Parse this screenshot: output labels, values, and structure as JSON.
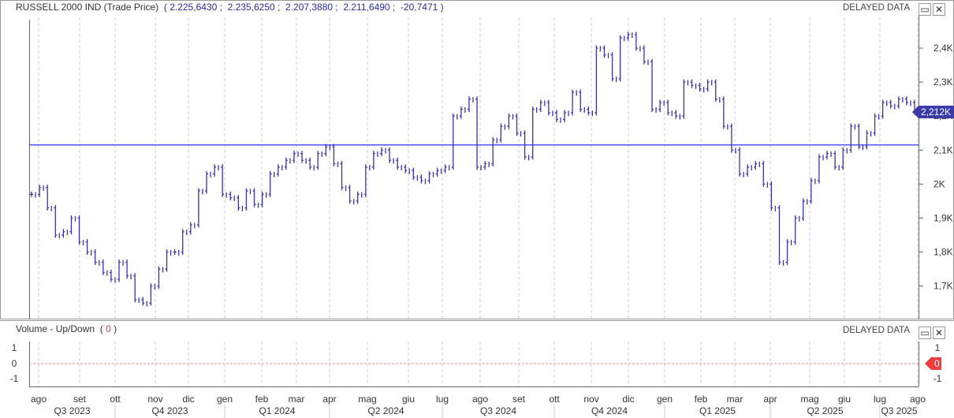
{
  "header": {
    "title": "RUSSELL 2000 IND (Trade Price)",
    "open": "2.225,6430",
    "high": "2.235,6250",
    "low": "2.207,3880",
    "close": "2.211,6490",
    "change": "-20,7471",
    "delayed": "DELAYED DATA"
  },
  "volume": {
    "title": "Volume - Up/Down",
    "value": "0",
    "delayed": "DELAYED DATA",
    "last_badge": "0"
  },
  "colors": {
    "series": "#3434a8",
    "ref_line": "#1a1aff",
    "badge": "#3a3aa8",
    "vol_badge": "#f03c3c"
  },
  "chart_data": {
    "type": "ohlc",
    "title": "RUSSELL 2000 IND (Trade Price)",
    "ylim": [
      1620,
      2470
    ],
    "y_ticks": [
      {
        "v": 2400,
        "label": "2,4K"
      },
      {
        "v": 2300,
        "label": "2,3K"
      },
      {
        "v": 2200,
        "label": "2,2K"
      },
      {
        "v": 2100,
        "label": "2,1K"
      },
      {
        "v": 2000,
        "label": "2K"
      },
      {
        "v": 1900,
        "label": "1,9K"
      },
      {
        "v": 1800,
        "label": "1,8K"
      },
      {
        "v": 1700,
        "label": "1,7K"
      }
    ],
    "reference_line": 2115,
    "last_label": "2,212K",
    "last_value": 2212,
    "closes": [
      1970,
      1990,
      1930,
      1850,
      1860,
      1900,
      1830,
      1800,
      1770,
      1740,
      1720,
      1770,
      1730,
      1660,
      1650,
      1700,
      1750,
      1800,
      1800,
      1860,
      1880,
      1980,
      2030,
      2050,
      1970,
      1960,
      1930,
      1980,
      1940,
      1970,
      2030,
      2050,
      2070,
      2090,
      2070,
      2050,
      2090,
      2110,
      2060,
      1990,
      1950,
      1970,
      2050,
      2090,
      2100,
      2070,
      2050,
      2040,
      2020,
      2010,
      2030,
      2040,
      2050,
      2200,
      2220,
      2250,
      2050,
      2060,
      2130,
      2170,
      2200,
      2150,
      2080,
      2220,
      2240,
      2210,
      2190,
      2210,
      2270,
      2220,
      2210,
      2400,
      2380,
      2310,
      2430,
      2440,
      2400,
      2360,
      2220,
      2240,
      2210,
      2200,
      2300,
      2290,
      2280,
      2300,
      2250,
      2170,
      2100,
      2030,
      2050,
      2060,
      2000,
      1930,
      1770,
      1830,
      1900,
      1950,
      2010,
      2080,
      2090,
      2050,
      2100,
      2170,
      2110,
      2150,
      2200,
      2240,
      2230,
      2250,
      2240,
      2212
    ],
    "months": [
      "ago",
      "set",
      "ott",
      "nov",
      "dic",
      "gen",
      "feb",
      "mar",
      "apr",
      "mag",
      "giu",
      "lug",
      "ago",
      "set",
      "ott",
      "nov",
      "dic",
      "gen",
      "feb",
      "mar",
      "apr",
      "mag",
      "giu",
      "lug",
      "ago"
    ],
    "quarters": [
      "Q3 2023",
      "Q4 2023",
      "Q1 2024",
      "Q2 2024",
      "Q3 2024",
      "Q4 2024",
      "Q1 2025",
      "Q2 2025",
      "Q3 2025"
    ],
    "volume_ticks": [
      "1",
      "0",
      "-1"
    ]
  }
}
